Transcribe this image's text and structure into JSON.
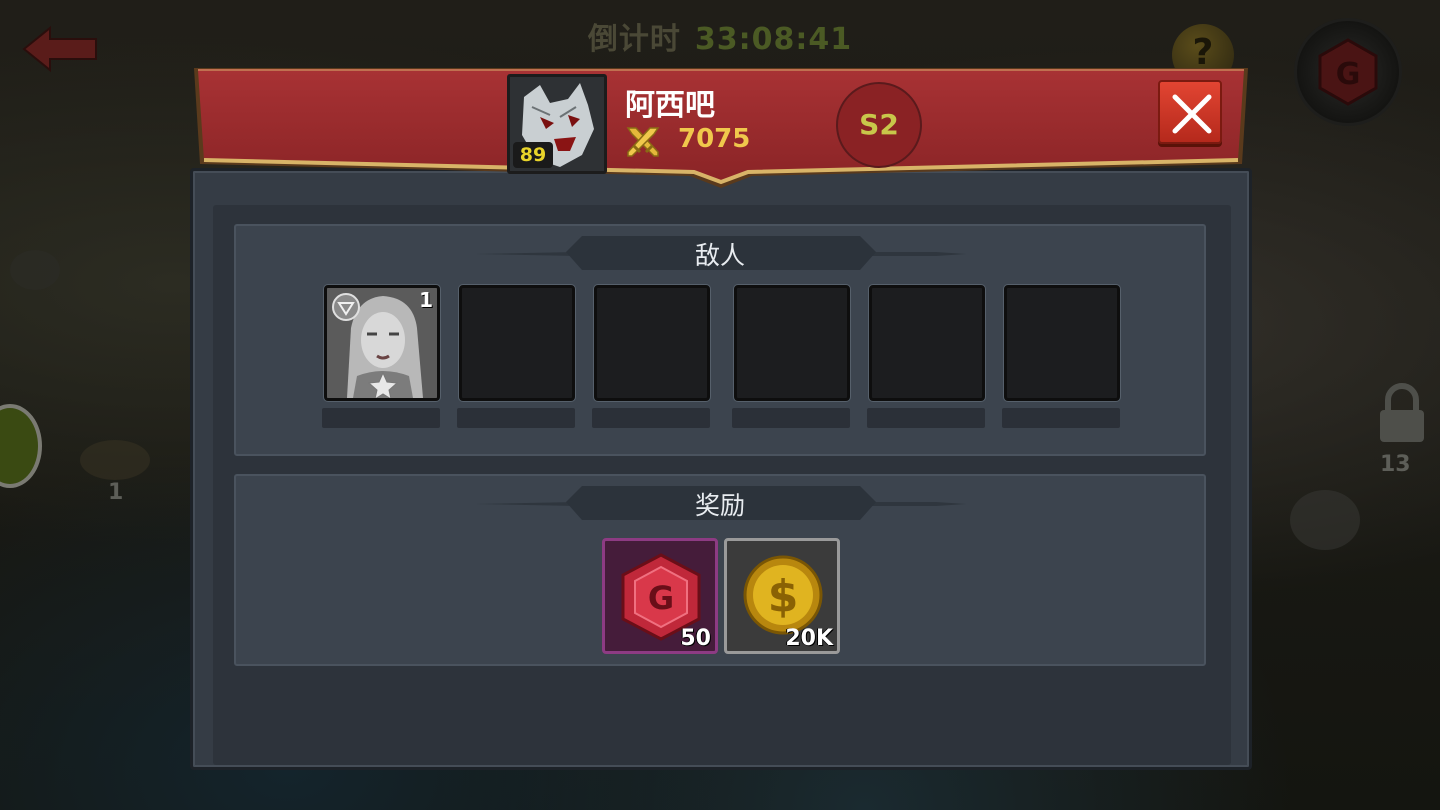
{
  "countdown": {
    "label": "倒计时",
    "time": "33:08:41"
  },
  "topbar": {
    "help_glyph": "?",
    "back_icon": "back-arrow-icon",
    "gem_icon": "gem-icon"
  },
  "map": {
    "lock_count": "13",
    "node_number": "1"
  },
  "opponent": {
    "name": "阿西吧",
    "level": "89",
    "power": "7075",
    "season": "S2",
    "avatar_icon": "werewolf-avatar-icon"
  },
  "enemy_section": {
    "title": "敌人",
    "slots": [
      {
        "filled": true,
        "count": "1",
        "hero_icon": "female-hero-portrait-icon",
        "star_icon": "star-icon"
      },
      {
        "filled": false
      },
      {
        "filled": false
      },
      {
        "filled": false
      },
      {
        "filled": false
      },
      {
        "filled": false
      }
    ]
  },
  "reward_section": {
    "title": "奖励",
    "rewards": [
      {
        "type": "gem",
        "icon": "gem-icon",
        "amount": "50"
      },
      {
        "type": "gold",
        "icon": "gold-coin-icon",
        "amount": "20K"
      }
    ]
  },
  "colors": {
    "header_red": "#9b2a2d",
    "header_trim": "#c8a45a",
    "power_gold": "#f0c84c",
    "level_yellow": "#e8d42a",
    "season_text": "#c8c74a",
    "close_red": "#d63a2a",
    "gem_border": "#8d3b83"
  }
}
